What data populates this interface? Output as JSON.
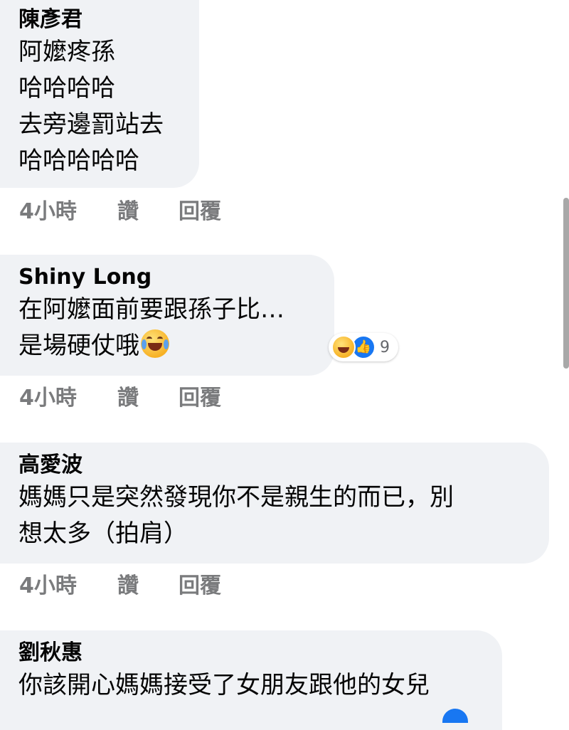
{
  "comments": [
    {
      "author": "陳彥君",
      "lines": [
        "阿嬤疼孫",
        "哈哈哈哈",
        "去旁邊罰站去",
        "哈哈哈哈哈"
      ],
      "time": "4小時",
      "like": "讚",
      "reply": "回覆"
    },
    {
      "author": "Shiny Long",
      "lines": [
        "在阿嬤面前要跟孫子比…",
        "是場硬仗哦"
      ],
      "trailing_emoji": "crying-laughing-emoji",
      "reactions": {
        "icons": [
          "haha",
          "like"
        ],
        "count": "9"
      },
      "time": "4小時",
      "like": "讚",
      "reply": "回覆"
    },
    {
      "author": "高愛波",
      "lines": [
        "媽媽只是突然發現你不是親生的而已，別",
        "想太多（拍肩）"
      ],
      "time": "4小時",
      "like": "讚",
      "reply": "回覆"
    },
    {
      "author": "劉秋惠",
      "lines": [
        "你該開心媽媽接受了女朋友跟他的女兒"
      ]
    }
  ],
  "colors": {
    "bubble": "#f0f2f5",
    "text": "#050505",
    "meta": "#7a7b7d",
    "like_blue": "#1877f2",
    "haha_yellow": "#f7b125"
  }
}
